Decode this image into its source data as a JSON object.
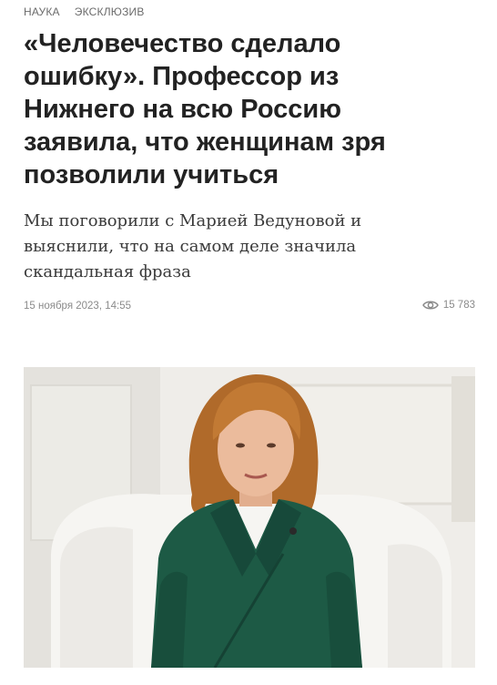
{
  "rubrics": [
    "НАУКА",
    "ЭКСКЛЮЗИВ"
  ],
  "article": {
    "title": "«Человечество сделало ошибку». Профессор из Нижнего на всю Россию заявила, что женщинам зря позволили учиться",
    "subtitle": "Мы поговорили с Марией Ведуновой и выяснили, что на самом деле значила скандальная фраза",
    "date": "15 ноября 2023, 14:55",
    "views": "15 783",
    "views_icon": "eye-icon"
  },
  "photo": {
    "subject": "woman-in-green-dress-seated-in-white-armchair",
    "colors": {
      "wall": "#eeece8",
      "chair": "#f4f3f0",
      "dress": "#1e5a45",
      "hair": "#b8702c",
      "skin": "#e8b898"
    }
  }
}
